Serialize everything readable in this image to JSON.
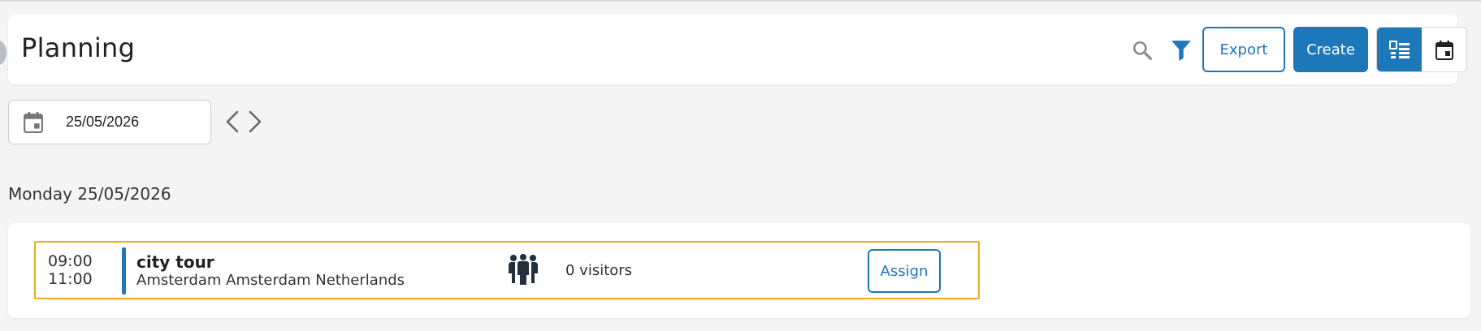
{
  "header": {
    "title": "Planning",
    "export_label": "Export",
    "create_label": "Create"
  },
  "icons": {
    "search": "search-icon",
    "filter": "filter-icon",
    "list_view": "list-view-icon",
    "calendar_view": "calendar-icon",
    "date_picker": "calendar-icon",
    "prev": "chevron-left-icon",
    "next": "chevron-right-icon",
    "visitors": "people-icon"
  },
  "colors": {
    "accent": "#1d78b9",
    "highlight_border": "#f2a81d"
  },
  "date_filter": {
    "value": "25/05/2026"
  },
  "day": {
    "heading": "Monday 25/05/2026"
  },
  "events": [
    {
      "start": "09:00",
      "end": "11:00",
      "title": "city tour",
      "location": "Amsterdam Amsterdam Netherlands",
      "visitors": "0 visitors",
      "assign_label": "Assign"
    }
  ]
}
